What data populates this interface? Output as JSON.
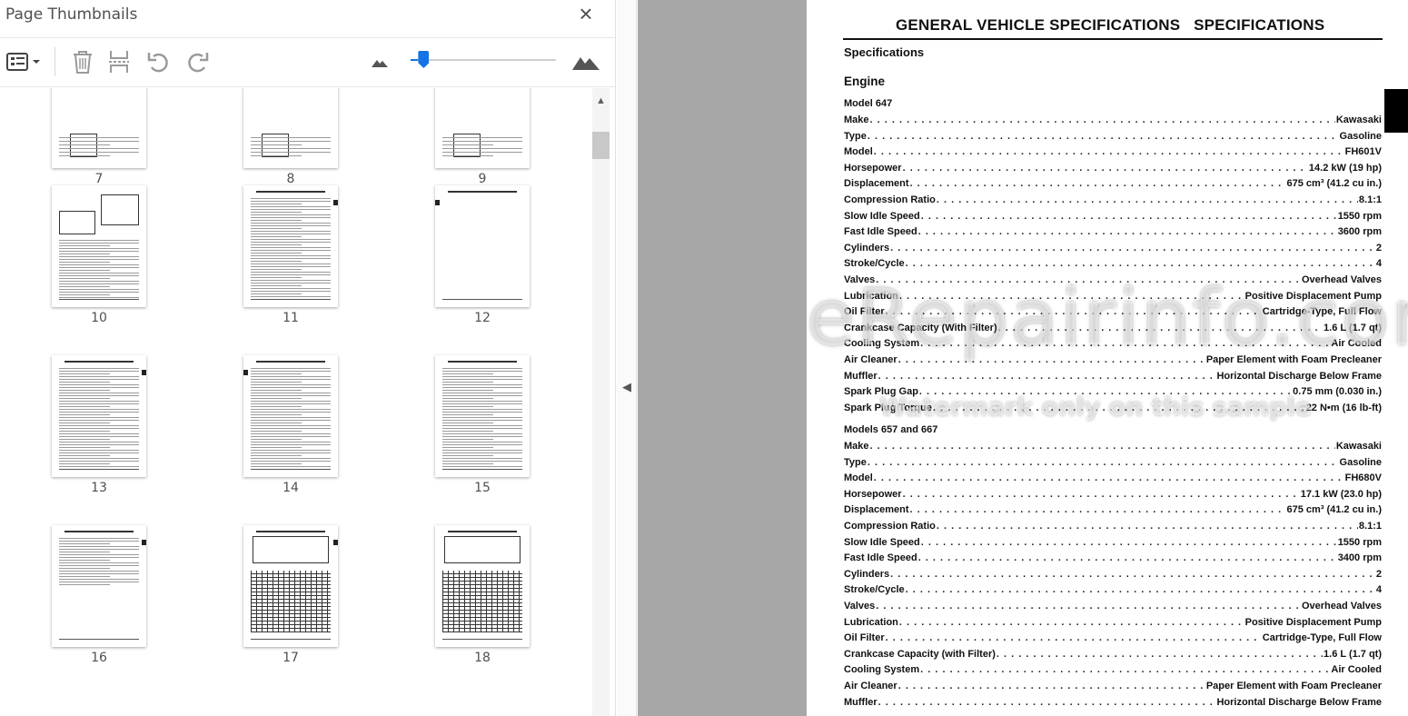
{
  "panel": {
    "title": "Page Thumbnails",
    "close_icon": "close-icon",
    "toolbar": {
      "options_icon": "thumbnail-options-icon",
      "delete_icon": "trash-icon",
      "extract_icon": "extract-pages-icon",
      "rotate_ccw_icon": "rotate-counterclockwise-icon",
      "rotate_cw_icon": "rotate-clockwise-icon",
      "zoom_out_icon": "small-mountain-icon",
      "zoom_in_icon": "large-mountain-icon",
      "slider_level": 0.04,
      "accent": "#1473e6"
    },
    "thumbnails": [
      {
        "label": "7"
      },
      {
        "label": "8"
      },
      {
        "label": "9"
      },
      {
        "label": "10"
      },
      {
        "label": "11"
      },
      {
        "label": "12"
      },
      {
        "label": "13"
      },
      {
        "label": "14"
      },
      {
        "label": "15"
      },
      {
        "label": "16"
      },
      {
        "label": "17"
      },
      {
        "label": "18"
      }
    ]
  },
  "document": {
    "title": "GENERAL VEHICLE SPECIFICATIONS   SPECIFICATIONS",
    "subtitle": "Specifications",
    "section": "Engine",
    "model_a": {
      "heading": "Model 647",
      "rows": [
        {
          "label": "Make",
          "value": "Kawasaki"
        },
        {
          "label": "Type",
          "value": "Gasoline"
        },
        {
          "label": "Model",
          "value": "FH601V"
        },
        {
          "label": "Horsepower",
          "value": "14.2 kW (19 hp)"
        },
        {
          "label": "Displacement",
          "value": "675 cm³ (41.2 cu in.)"
        },
        {
          "label": "Compression Ratio",
          "value": "8.1:1"
        },
        {
          "label": "Slow Idle Speed",
          "value": "1550 rpm"
        },
        {
          "label": "Fast Idle Speed",
          "value": "3600 rpm"
        },
        {
          "label": "Cylinders",
          "value": "2"
        },
        {
          "label": "Stroke/Cycle",
          "value": "4"
        },
        {
          "label": "Valves",
          "value": "Overhead Valves"
        },
        {
          "label": "Lubrication",
          "value": "Positive Displacement Pump"
        },
        {
          "label": "Oil Filter",
          "value": "Cartridge-Type, Full Flow"
        },
        {
          "label": "Crankcase Capacity (With Filter)",
          "value": "1.6 L (1.7 qt)"
        },
        {
          "label": "Cooling System",
          "value": "Air Cooled"
        },
        {
          "label": "Air Cleaner",
          "value": "Paper Element with Foam Precleaner"
        },
        {
          "label": "Muffler",
          "value": "Horizontal Discharge Below Frame"
        },
        {
          "label": "Spark Plug Gap",
          "value": "0.75 mm (0.030 in.)"
        },
        {
          "label": "Spark Plug Torque",
          "value": "22 N•m (16 lb-ft)"
        }
      ]
    },
    "model_b": {
      "heading": "Models 657 and 667",
      "rows": [
        {
          "label": "Make",
          "value": "Kawasaki"
        },
        {
          "label": "Type",
          "value": "Gasoline"
        },
        {
          "label": "Model",
          "value": "FH680V"
        },
        {
          "label": "Horsepower",
          "value": "17.1 kW (23.0 hp)"
        },
        {
          "label": "Displacement",
          "value": "675 cm³ (41.2 cu in.)"
        },
        {
          "label": "Compression Ratio",
          "value": "8.1:1"
        },
        {
          "label": "Slow Idle Speed",
          "value": "1550 rpm"
        },
        {
          "label": "Fast Idle Speed",
          "value": "3400 rpm"
        },
        {
          "label": "Cylinders",
          "value": "2"
        },
        {
          "label": "Stroke/Cycle",
          "value": "4"
        },
        {
          "label": "Valves",
          "value": "Overhead Valves"
        },
        {
          "label": "Lubrication",
          "value": "Positive Displacement Pump"
        },
        {
          "label": "Oil Filter",
          "value": "Cartridge-Type, Full Flow"
        },
        {
          "label": "Crankcase Capacity (with Filter)",
          "value": "1.6 L (1.7 qt)"
        },
        {
          "label": "Cooling System",
          "value": "Air Cooled"
        },
        {
          "label": "Air Cleaner",
          "value": "Paper Element with Foam Precleaner"
        },
        {
          "label": "Muffler",
          "value": "Horizontal Discharge Below Frame"
        }
      ]
    },
    "watermark": "eRepairinfo.com",
    "watermark_note": "Watermark only on this sample"
  }
}
